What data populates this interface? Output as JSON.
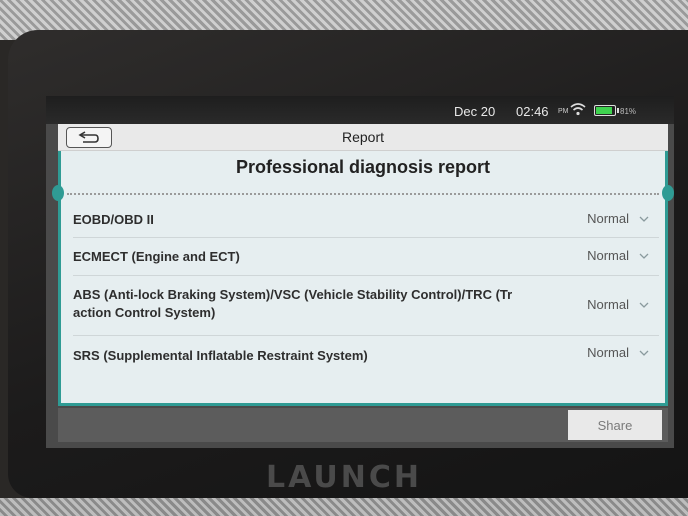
{
  "status_bar": {
    "date": "Dec 20",
    "time": "02:46",
    "ampm": "PM",
    "battery": "81%"
  },
  "titlebar": {
    "title": "Report",
    "back_icon": "back-arrow-icon"
  },
  "report": {
    "heading": "Professional diagnosis report",
    "rows": [
      {
        "label": "EOBD/OBD II",
        "status": "Normal"
      },
      {
        "label": "ECMECT (Engine and ECT)",
        "status": "Normal"
      },
      {
        "label": "ABS (Anti-lock Braking System)/VSC (Vehicle Stability Control)/TRC (Tr action Control System)",
        "status": "Normal"
      },
      {
        "label": "SRS (Supplemental Inflatable Restraint System)",
        "status": "Normal"
      }
    ]
  },
  "footer": {
    "share_label": "Share"
  },
  "device": {
    "brand": "LAUNCH"
  },
  "colors": {
    "accent": "#2f9b94",
    "battery": "#3fd24f"
  }
}
